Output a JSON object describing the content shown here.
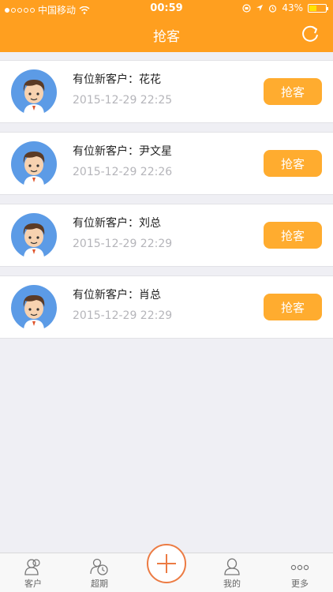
{
  "status_bar": {
    "carrier": "中国移动",
    "time": "00:59",
    "battery": "43%",
    "battery_level": 0.43
  },
  "header": {
    "title": "抢客",
    "refresh_icon": "refresh-icon"
  },
  "items": [
    {
      "title": "有位新客户：花花",
      "date": "2015-12-29 22:25",
      "button": "抢客"
    },
    {
      "title": "有位新客户：尹文星",
      "date": "2015-12-29 22:26",
      "button": "抢客"
    },
    {
      "title": "有位新客户：刘总",
      "date": "2015-12-29 22:29",
      "button": "抢客"
    },
    {
      "title": "有位新客户：肖总",
      "date": "2015-12-29 22:29",
      "button": "抢客"
    }
  ],
  "tabbar": {
    "tabs": [
      {
        "label": "客户",
        "icon": "customers-icon"
      },
      {
        "label": "超期",
        "icon": "overdue-icon"
      },
      {
        "label": "",
        "icon": "plus-icon"
      },
      {
        "label": "我的",
        "icon": "profile-icon"
      },
      {
        "label": "更多",
        "icon": "more-icon"
      }
    ]
  },
  "colors": {
    "header": "#ff9f1f",
    "button": "#ffac2f",
    "accent": "#ec7b43"
  }
}
